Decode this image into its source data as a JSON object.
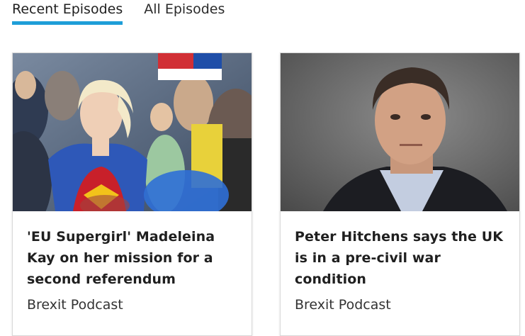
{
  "tabs": {
    "recent": "Recent Episodes",
    "all": "All Episodes",
    "active_color": "#1e9ed8"
  },
  "episodes": [
    {
      "title": "'EU Supergirl' Madeleina Kay on her mission for a second referendum",
      "podcast": "Brexit Podcast",
      "image": "protest-crowd-supergirl-photo"
    },
    {
      "title": "Peter Hitchens says the UK is in a pre-civil war condition",
      "podcast": "Brexit Podcast",
      "image": "man-portrait-photo"
    }
  ]
}
